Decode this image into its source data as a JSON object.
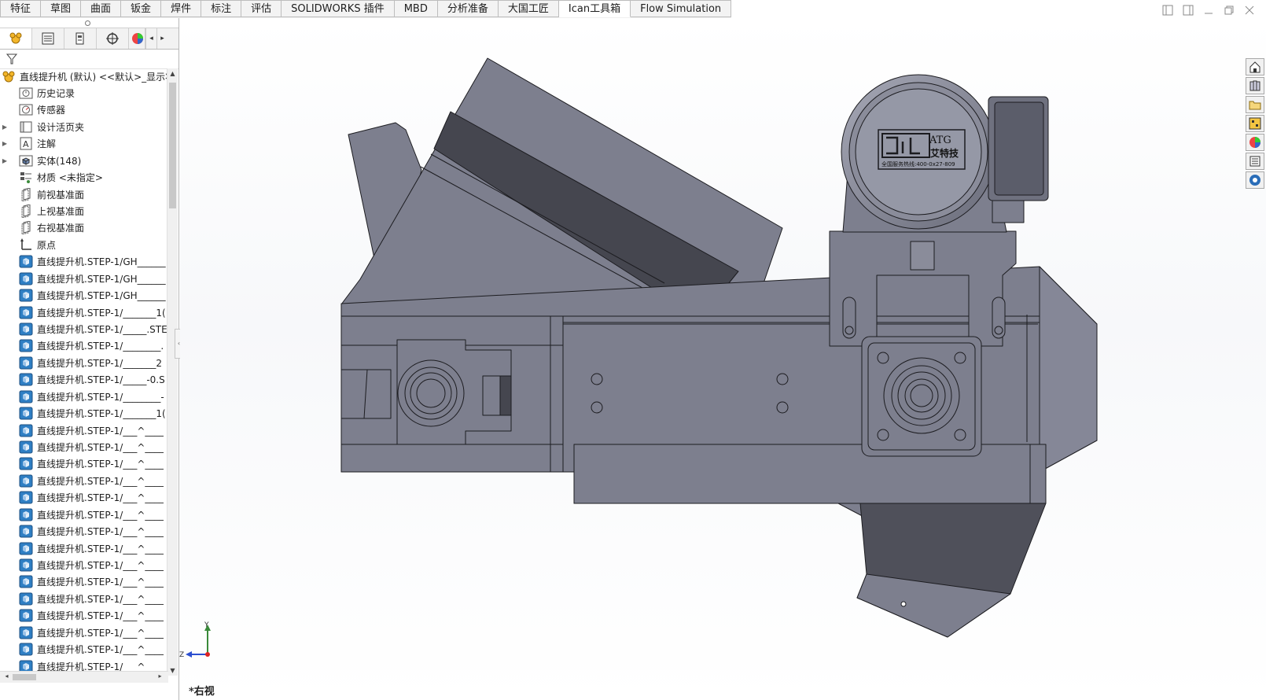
{
  "tabs": [
    {
      "label": "特征",
      "active": false
    },
    {
      "label": "草图",
      "active": false
    },
    {
      "label": "曲面",
      "active": false
    },
    {
      "label": "钣金",
      "active": false
    },
    {
      "label": "焊件",
      "active": false
    },
    {
      "label": "标注",
      "active": false
    },
    {
      "label": "评估",
      "active": false
    },
    {
      "label": "SOLIDWORKS 插件",
      "active": false
    },
    {
      "label": "MBD",
      "active": false
    },
    {
      "label": "分析准备",
      "active": false
    },
    {
      "label": "大国工匠",
      "active": false
    },
    {
      "label": "Ican工具箱",
      "active": true
    },
    {
      "label": "Flow Simulation",
      "active": false
    }
  ],
  "tree": {
    "root": "直线提升机 (默认) <<默认>_显示状态",
    "items": [
      {
        "label": "历史记录",
        "icon": "history-icon",
        "expandable": false
      },
      {
        "label": "传感器",
        "icon": "sensor-icon",
        "expandable": false
      },
      {
        "label": "设计活页夹",
        "icon": "design-binder-icon",
        "expandable": true
      },
      {
        "label": "注解",
        "icon": "annotation-icon",
        "expandable": true
      },
      {
        "label": "实体(148)",
        "icon": "solid-bodies-icon",
        "expandable": true
      },
      {
        "label": "材质 <未指定>",
        "icon": "material-icon",
        "expandable": false
      },
      {
        "label": "前视基准面",
        "icon": "plane-icon",
        "expandable": false
      },
      {
        "label": "上视基准面",
        "icon": "plane-icon",
        "expandable": false
      },
      {
        "label": "右视基准面",
        "icon": "plane-icon",
        "expandable": false
      },
      {
        "label": "原点",
        "icon": "origin-icon",
        "expandable": false
      },
      {
        "label": "直线提升机.STEP-1/GH______",
        "icon": "part-icon",
        "expandable": false
      },
      {
        "label": "直线提升机.STEP-1/GH______",
        "icon": "part-icon",
        "expandable": false
      },
      {
        "label": "直线提升机.STEP-1/GH______",
        "icon": "part-icon",
        "expandable": false
      },
      {
        "label": "直线提升机.STEP-1/_______1(",
        "icon": "part-icon",
        "expandable": false
      },
      {
        "label": "直线提升机.STEP-1/_____.STE",
        "icon": "part-icon",
        "expandable": false
      },
      {
        "label": "直线提升机.STEP-1/________.",
        "icon": "part-icon",
        "expandable": false
      },
      {
        "label": "直线提升机.STEP-1/_______2",
        "icon": "part-icon",
        "expandable": false
      },
      {
        "label": "直线提升机.STEP-1/_____-0.S",
        "icon": "part-icon",
        "expandable": false
      },
      {
        "label": "直线提升机.STEP-1/________-",
        "icon": "part-icon",
        "expandable": false
      },
      {
        "label": "直线提升机.STEP-1/_______1(",
        "icon": "part-icon",
        "expandable": false
      },
      {
        "label": "直线提升机.STEP-1/___^____",
        "icon": "part-icon",
        "expandable": false
      },
      {
        "label": "直线提升机.STEP-1/___^____",
        "icon": "part-icon",
        "expandable": false
      },
      {
        "label": "直线提升机.STEP-1/___^____",
        "icon": "part-icon",
        "expandable": false
      },
      {
        "label": "直线提升机.STEP-1/___^____",
        "icon": "part-icon",
        "expandable": false
      },
      {
        "label": "直线提升机.STEP-1/___^____",
        "icon": "part-icon",
        "expandable": false
      },
      {
        "label": "直线提升机.STEP-1/___^____",
        "icon": "part-icon",
        "expandable": false
      },
      {
        "label": "直线提升机.STEP-1/___^____",
        "icon": "part-icon",
        "expandable": false
      },
      {
        "label": "直线提升机.STEP-1/___^____",
        "icon": "part-icon",
        "expandable": false
      },
      {
        "label": "直线提升机.STEP-1/___^____",
        "icon": "part-icon",
        "expandable": false
      },
      {
        "label": "直线提升机.STEP-1/___^____",
        "icon": "part-icon",
        "expandable": false
      },
      {
        "label": "直线提升机.STEP-1/___^____",
        "icon": "part-icon",
        "expandable": false
      },
      {
        "label": "直线提升机.STEP-1/___^____",
        "icon": "part-icon",
        "expandable": false
      },
      {
        "label": "直线提升机.STEP-1/___^____",
        "icon": "part-icon",
        "expandable": false
      },
      {
        "label": "直线提升机.STEP-1/___^____",
        "icon": "part-icon",
        "expandable": false
      },
      {
        "label": "直线提升机.STEP-1/___^____",
        "icon": "part-icon",
        "expandable": false
      },
      {
        "label": "直线提升机.STEP-1/___^____",
        "icon": "part-icon",
        "expandable": false
      }
    ]
  },
  "motor_label": {
    "brand": "ATG",
    "name": "艾特技",
    "hotline": "全国服务热线:400-0x27-809"
  },
  "view": {
    "label": "*右视"
  },
  "triad": {
    "y": "Y",
    "z": "Z"
  },
  "colors": {
    "part": "#7d7f8e",
    "part_dark": "#45464f",
    "part_light": "#9b9dab",
    "edge": "#1c1c20"
  }
}
